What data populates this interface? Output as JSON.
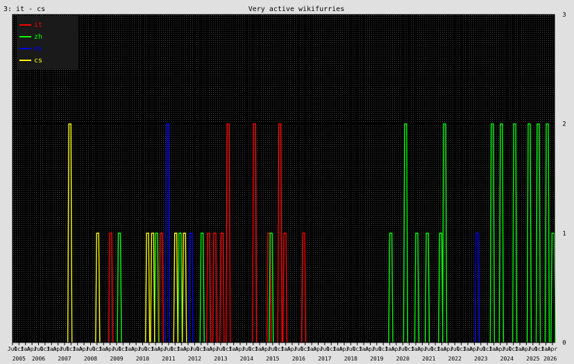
{
  "header": {
    "left_label": "3: it - cs"
  },
  "chart_data": {
    "type": "line",
    "title": "Very active wikifurries",
    "xlabel": "",
    "ylabel": "",
    "ylim": [
      0,
      3
    ],
    "y_ticks": [
      "0",
      "1",
      "2",
      "3"
    ],
    "x_range": [
      "2005-07",
      "2026-05"
    ],
    "x_year_labels": [
      "2005",
      "2006",
      "2007",
      "2008",
      "2009",
      "2010",
      "2011",
      "2012",
      "2013",
      "2014",
      "2015",
      "2016",
      "2017",
      "2018",
      "2019",
      "2020",
      "2021",
      "2022",
      "2023",
      "2024",
      "2025",
      "2026"
    ],
    "x_month_tick_labels": [
      "Jul",
      "Oct",
      "Jan",
      "Apr"
    ],
    "background": "#000000",
    "grid": true,
    "legend_position": "top-left",
    "series": [
      {
        "name": "it",
        "color": "#ff0000",
        "points": [
          [
            "2009-04-10",
            1
          ],
          [
            "2011-03-20",
            1
          ],
          [
            "2013-01-15",
            1
          ],
          [
            "2013-04-10",
            1
          ],
          [
            "2013-07-20",
            1
          ],
          [
            "2013-10-15",
            2
          ],
          [
            "2014-10-20",
            2
          ],
          [
            "2015-05-10",
            1
          ],
          [
            "2015-10-10",
            2
          ],
          [
            "2015-12-20",
            1
          ],
          [
            "2016-09-10",
            1
          ]
        ]
      },
      {
        "name": "zh",
        "color": "#00ff00",
        "points": [
          [
            "2009-08-10",
            1
          ],
          [
            "2011-01-15",
            1
          ],
          [
            "2011-12-10",
            1
          ],
          [
            "2012-10-15",
            1
          ],
          [
            "2015-06-10",
            1
          ],
          [
            "2020-01-15",
            1
          ],
          [
            "2020-08-10",
            2
          ],
          [
            "2021-01-15",
            1
          ],
          [
            "2021-06-10",
            1
          ],
          [
            "2021-12-15",
            1
          ],
          [
            "2022-02-10",
            2
          ],
          [
            "2023-12-10",
            2
          ],
          [
            "2024-04-15",
            2
          ],
          [
            "2024-10-20",
            2
          ],
          [
            "2025-05-10",
            2
          ],
          [
            "2025-09-15",
            2
          ],
          [
            "2026-01-20",
            2
          ],
          [
            "2026-04-10",
            1
          ]
        ]
      },
      {
        "name": "es",
        "color": "#0000ff",
        "points": [
          [
            "2011-06-15",
            2
          ],
          [
            "2012-05-10",
            1
          ],
          [
            "2023-05-10",
            1
          ]
        ]
      },
      {
        "name": "cs",
        "color": "#ffff00",
        "points": [
          [
            "2007-09-15",
            2
          ],
          [
            "2008-10-10",
            1
          ],
          [
            "2010-09-10",
            1
          ],
          [
            "2010-11-20",
            1
          ],
          [
            "2011-10-10",
            1
          ],
          [
            "2012-02-10",
            1
          ]
        ]
      }
    ]
  }
}
